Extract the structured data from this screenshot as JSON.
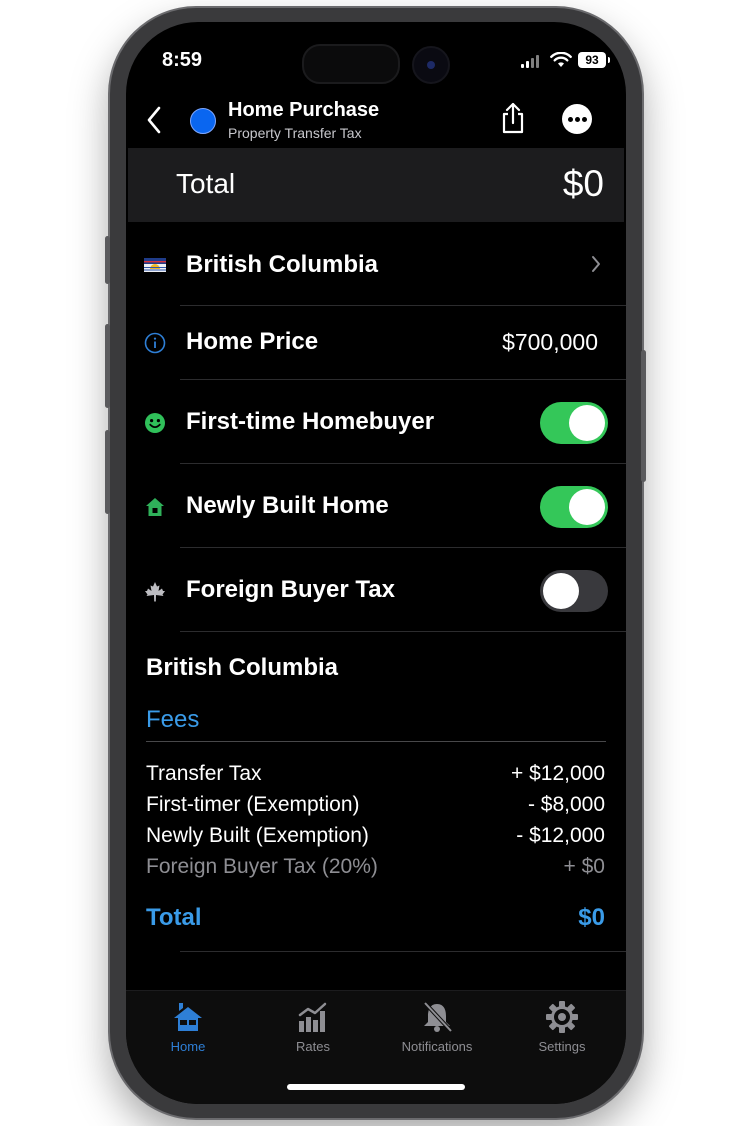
{
  "status": {
    "time": "8:59",
    "battery": "93"
  },
  "header": {
    "title": "Home Purchase",
    "subtitle": "Property Transfer Tax",
    "dot_color": "#0a66f0"
  },
  "total": {
    "label": "Total",
    "value": "$0"
  },
  "province": {
    "name": "British Columbia"
  },
  "home_price": {
    "label": "Home Price",
    "value": "$700,000"
  },
  "toggles": [
    {
      "label": "First-time Homebuyer",
      "on": true
    },
    {
      "label": "Newly Built Home",
      "on": true
    },
    {
      "label": "Foreign Buyer Tax",
      "on": false
    }
  ],
  "breakdown": {
    "region": "British Columbia",
    "section": "Fees",
    "items": [
      {
        "label": "Transfer Tax",
        "value": "+ $12,000"
      },
      {
        "label": "First-timer (Exemption)",
        "value": "- $8,000"
      },
      {
        "label": "Newly Built (Exemption)",
        "value": "- $12,000"
      },
      {
        "label": "Foreign Buyer Tax (20%)",
        "value": "+ $0"
      }
    ],
    "total_label": "Total",
    "total_value": "$0"
  },
  "tabs": [
    {
      "label": "Home",
      "icon": "house-icon",
      "active": true
    },
    {
      "label": "Rates",
      "icon": "chart-bars-icon",
      "active": false
    },
    {
      "label": "Notifications",
      "icon": "bell-slash-icon",
      "active": false
    },
    {
      "label": "Settings",
      "icon": "gear-icon",
      "active": false
    }
  ],
  "colors": {
    "accent": "#3a9be8",
    "toggle_on": "#34c759",
    "tab_active": "#2e7fd6"
  }
}
